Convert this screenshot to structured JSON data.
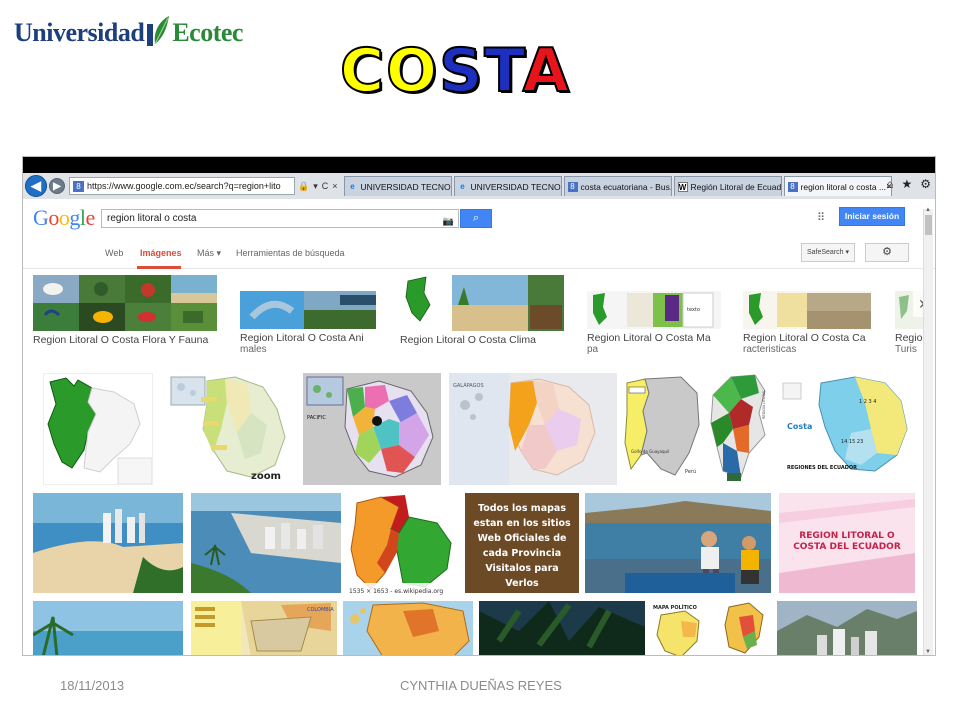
{
  "logo": {
    "part1": "Universidad",
    "part2": "Ecotec"
  },
  "title": {
    "letters": [
      {
        "ch": "C",
        "color": "#ffff00"
      },
      {
        "ch": "O",
        "color": "#ffff00"
      },
      {
        "ch": "S",
        "color": "#1c2fbf"
      },
      {
        "ch": "T",
        "color": "#1c2fbf"
      },
      {
        "ch": "A",
        "color": "#e8141c"
      }
    ]
  },
  "browser": {
    "url": "https://www.google.com.ec/search?q=region+lito",
    "url_tools": [
      "🔒",
      "▾",
      "C",
      "×"
    ],
    "tabs": [
      {
        "icon": "ie",
        "label": "UNIVERSIDAD TECNOL...",
        "active": false
      },
      {
        "icon": "ie",
        "label": "UNIVERSIDAD TECNOL...",
        "active": false
      },
      {
        "icon": "google",
        "label": "costa ecuatoriana - Bus...",
        "active": false
      },
      {
        "icon": "wiki",
        "label": "Región Litoral de Ecuad...",
        "active": false
      },
      {
        "icon": "google",
        "label": "region litoral o costa ...",
        "active": true
      }
    ],
    "window_tools": [
      "home-icon",
      "star-icon",
      "gear-icon"
    ]
  },
  "google": {
    "logo": "Google",
    "query": "region litoral o costa",
    "signin": "Iniciar sesión",
    "nav": {
      "web": "Web",
      "images": "Imágenes",
      "more": "Más ▾",
      "tools": "Herramientas de búsqueda"
    },
    "safesearch": "SafeSearch ▾",
    "related": [
      {
        "label": "Region Litoral O Costa Flora Y Fauna",
        "sub": ""
      },
      {
        "label": "Region Litoral O Costa Ani",
        "sub": "males"
      },
      {
        "label": "Region Litoral O Costa Clima",
        "sub": ""
      },
      {
        "label": "Region Litoral O Costa Ma",
        "sub": "pa"
      },
      {
        "label": "Region Litoral O Costa Ca",
        "sub": "racteristicas"
      },
      {
        "label": "Regio",
        "sub": "Turis"
      }
    ],
    "image_texts": {
      "wiki_caption": "1535 × 1653 - es.wikipedia.org",
      "mapas_text": "Todos los mapas estan en los sitios Web Oficiales de cada Provincia Visitalos para Verlos",
      "region_pink": "REGION LITORAL O COSTA DEL ECUADOR",
      "regiones_label": "REGIONES DEL ECUADOR",
      "costa_label": "Costa",
      "zoom_label": "zoom",
      "mapa_politico": "MAPA POLÍTICO"
    }
  },
  "footer": {
    "date": "18/11/2013",
    "author": "CYNTHIA DUEÑAS REYES"
  }
}
